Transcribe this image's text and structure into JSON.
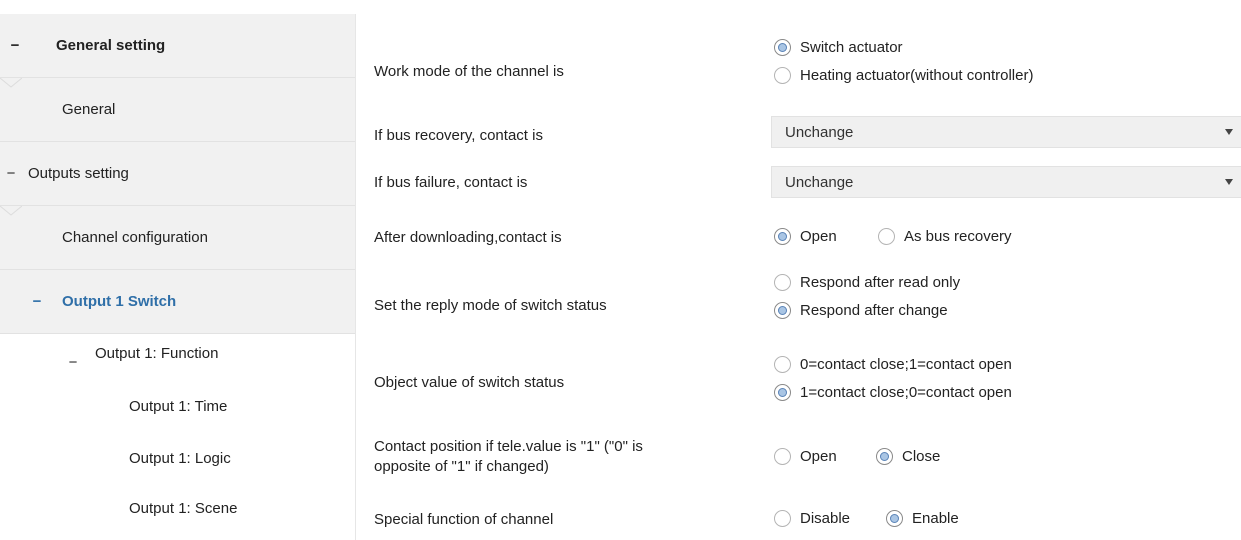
{
  "sidebar": {
    "general_setting": "General setting",
    "general": "General",
    "outputs_setting": "Outputs setting",
    "channel_configuration": "Channel configuration",
    "output_1_switch": "Output 1 Switch",
    "output_1_function": "Output 1: Function",
    "output_1_time": "Output 1: Time",
    "output_1_logic": "Output 1: Logic",
    "output_1_scene": "Output 1: Scene",
    "toggle_symbol": "−"
  },
  "params": {
    "work_mode": {
      "label": "Work mode of the channel is",
      "options": [
        "Switch actuator",
        "Heating actuator(without controller)"
      ],
      "selected": "Switch actuator"
    },
    "bus_recovery": {
      "label": "If bus recovery, contact is",
      "value": "Unchange"
    },
    "bus_failure": {
      "label": "If bus failure, contact is",
      "value": "Unchange"
    },
    "after_download": {
      "label": "After downloading,contact is",
      "options": [
        "Open",
        "As bus recovery"
      ],
      "selected": "Open"
    },
    "reply_mode": {
      "label": "Set the reply mode of switch status",
      "options": [
        "Respond after read only",
        "Respond after change"
      ],
      "selected": "Respond after change"
    },
    "object_value": {
      "label": "Object value of switch status",
      "options": [
        "0=contact close;1=contact open",
        "1=contact close;0=contact open"
      ],
      "selected": "1=contact close;0=contact open"
    },
    "contact_position": {
      "label_line1": "Contact position if tele.value is \"1\" (\"0\" is",
      "label_line2": "opposite of \"1\" if changed)",
      "options": [
        "Open",
        "Close"
      ],
      "selected": "Close"
    },
    "special_function": {
      "label": "Special function of channel",
      "options": [
        "Disable",
        "Enable"
      ],
      "selected": "Enable"
    }
  }
}
